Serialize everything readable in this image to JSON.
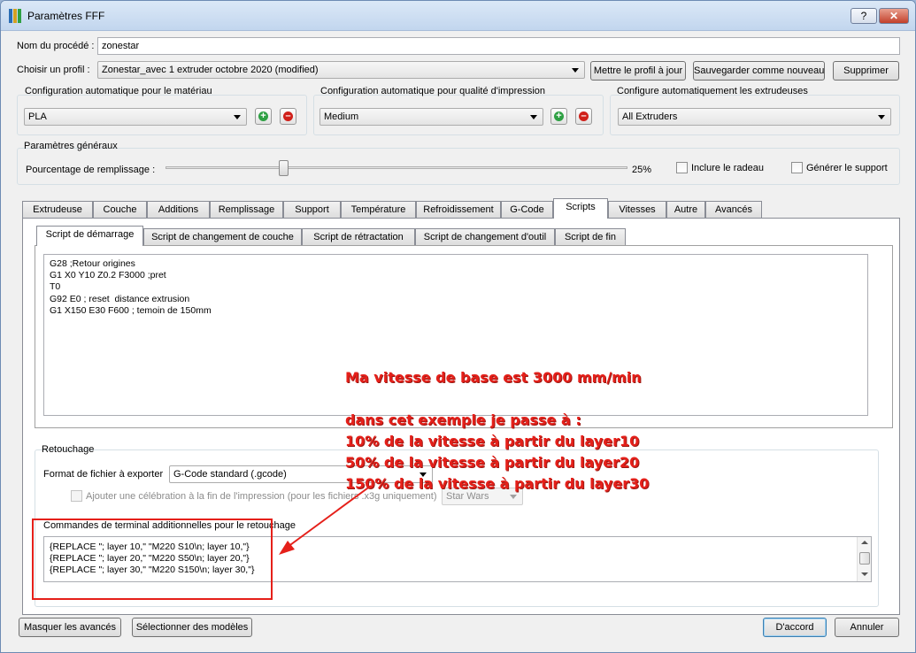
{
  "window": {
    "title": "Paramètres FFF",
    "help_label": "?",
    "close_label": "✕"
  },
  "process": {
    "name_label": "Nom du procédé :",
    "name_value": "zonestar",
    "profile_label": "Choisir un profil :",
    "profile_value": "Zonestar_avec 1 extruder octobre 2020 (modified)",
    "update_button": "Mettre le profil à jour",
    "save_new_button": "Sauvegarder comme nouveau",
    "delete_button": "Supprimer"
  },
  "auto_config": {
    "material": {
      "title": "Configuration automatique pour le matériau",
      "value": "PLA"
    },
    "quality": {
      "title": "Configuration automatique pour qualité d'impression",
      "value": "Medium"
    },
    "extruders": {
      "title": "Configure automatiquement les extrudeuses",
      "value": "All Extruders"
    }
  },
  "general": {
    "title": "Paramètres généraux",
    "infill_label": "Pourcentage de remplissage :",
    "infill_value": "25%",
    "infill_fraction": 0.25,
    "raft_label": "Inclure le radeau",
    "support_label": "Générer le support"
  },
  "tabs": [
    "Extrudeuse",
    "Couche",
    "Additions",
    "Remplissage",
    "Support",
    "Température",
    "Refroidissement",
    "G-Code",
    "Scripts",
    "Vitesses",
    "Autre",
    "Avancés"
  ],
  "active_tab": "Scripts",
  "subtabs": [
    "Script de démarrage",
    "Script de changement de couche",
    "Script de rétractation",
    "Script de changement d'outil",
    "Script de fin"
  ],
  "active_subtab": "Script de démarrage",
  "start_script_lines": [
    "G28 ;Retour origines",
    "G1 X0 Y10 Z0.2 F3000 ;pret",
    "T0",
    "G92 E0 ; reset  distance extrusion",
    "G1 X150 E30 F600 ; temoin de 150mm"
  ],
  "retouch": {
    "title": "Retouchage",
    "format_label": "Format de fichier à exporter",
    "format_value": "G-Code standard (.gcode)",
    "celebrate_label": "Ajouter une célébration à la fin de l'impression (pour les fichiers .x3g uniquement)",
    "celebrate_value": "Star Wars",
    "commands_label": "Commandes de terminal additionnelles pour le retouchage",
    "commands_lines": [
      "{REPLACE \"; layer 10,\" \"M220 S10\\n; layer 10,\"}",
      "{REPLACE \"; layer 20,\" \"M220 S50\\n; layer 20,\"}",
      "{REPLACE \"; layer 30,\" \"M220 S150\\n; layer 30,\"}"
    ]
  },
  "annotation": {
    "line1": "Ma vitesse de base est 3000 mm/min",
    "line2": "dans cet exemple je passe à :",
    "line3": "10% de la vitesse à partir du layer10",
    "line4": "50% de la vitesse à partir du layer20",
    "line5": "150% de la vitesse à partir du layer30",
    "color": "#e5201a"
  },
  "footer": {
    "hide_advanced_button": "Masquer les avancés",
    "select_models_button": "Sélectionner des modèles",
    "ok_button": "D'accord",
    "cancel_button": "Annuler"
  },
  "colors": {
    "add": "#2ea043",
    "remove": "#d0201a",
    "accent": "#3c7fb1"
  }
}
